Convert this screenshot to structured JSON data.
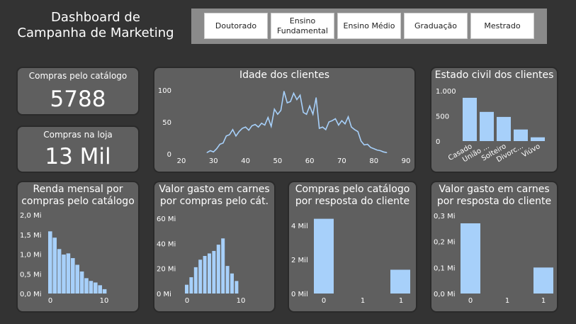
{
  "title_line1": "Dashboard de",
  "title_line2": "Campanha de Marketing",
  "slicer": [
    "Doutorado",
    "Ensino Fundamental",
    "Ensino Médio",
    "Graduação",
    "Mestrado"
  ],
  "kpis": {
    "catalog": {
      "label": "Compras pelo catálogo",
      "value": "5788"
    },
    "store": {
      "label": "Compras na loja",
      "value": "13 Mil"
    }
  },
  "colors": {
    "background": "#333333",
    "card": "#5f5f5f",
    "bar": "#a7d0fa",
    "line": "#a7d0fa",
    "slicer": "#8a8a8a"
  },
  "chart_data": [
    {
      "type": "line",
      "title": "Idade dos clientes",
      "x": [
        28,
        29,
        30,
        31,
        32,
        33,
        34,
        35,
        36,
        37,
        38,
        39,
        40,
        41,
        42,
        43,
        44,
        45,
        46,
        47,
        48,
        49,
        50,
        51,
        52,
        53,
        54,
        55,
        56,
        57,
        58,
        59,
        60,
        61,
        62,
        63,
        64,
        65,
        66,
        67,
        68,
        69,
        70,
        71,
        72,
        73,
        74,
        75,
        76,
        77,
        78,
        79,
        80,
        81,
        82,
        83,
        84
      ],
      "y": [
        2,
        5,
        3,
        8,
        15,
        17,
        28,
        30,
        38,
        28,
        35,
        40,
        42,
        37,
        44,
        46,
        42,
        48,
        45,
        57,
        43,
        70,
        62,
        68,
        98,
        80,
        82,
        95,
        85,
        92,
        65,
        62,
        75,
        62,
        88,
        40,
        42,
        38,
        50,
        52,
        55,
        45,
        52,
        47,
        58,
        42,
        38,
        35,
        20,
        14,
        15,
        10,
        8,
        6,
        5,
        3,
        2
      ],
      "xticks": [
        20,
        30,
        40,
        50,
        60,
        70,
        80,
        90
      ],
      "yticks": [
        0,
        50,
        100
      ],
      "xlim": [
        20,
        90
      ],
      "ylim": [
        0,
        100
      ]
    },
    {
      "type": "bar",
      "title": "Estado civil dos clientes",
      "categories": [
        "Casado",
        "União ...",
        "Solteiro",
        "Divorc...",
        "Viúvo"
      ],
      "values": [
        860,
        580,
        480,
        230,
        75
      ],
      "yticks": [
        "0",
        "500",
        "1.000"
      ],
      "ylim": [
        0,
        1000
      ]
    },
    {
      "type": "bar",
      "title": "Renda mensal por compras pelo catálogo",
      "categories": [
        0,
        1,
        2,
        3,
        4,
        5,
        6,
        7,
        8,
        9,
        10,
        11,
        12
      ],
      "values": [
        1.58,
        1.42,
        1.13,
        0.99,
        1.02,
        0.9,
        0.73,
        0.56,
        0.39,
        0.32,
        0.28,
        0.21,
        0.11
      ],
      "yticks": [
        "0,0 Mi",
        "0,5 Mi",
        "1,0 Mi",
        "1,5 Mi",
        "2,0 Mi"
      ],
      "xticks": [
        "0",
        "10"
      ],
      "ylim": [
        0,
        2.0
      ]
    },
    {
      "type": "bar",
      "title": "Valor gasto em carnes por compras pelo cát.",
      "categories": [
        0,
        1,
        2,
        3,
        4,
        5,
        6,
        7,
        8,
        9,
        10,
        11
      ],
      "values": [
        7,
        13,
        21,
        27,
        30,
        32,
        34,
        39,
        44,
        22,
        16,
        10
      ],
      "yticks": [
        "0 Mi",
        "20 Mi",
        "40 Mi",
        "60 Mi"
      ],
      "xticks": [
        "0",
        "10"
      ],
      "ylim": [
        0,
        60
      ]
    },
    {
      "type": "bar",
      "title": "Compras pelo catálogo por resposta do cliente",
      "categories": [
        "0",
        "1"
      ],
      "values": [
        4.4,
        1.4
      ],
      "yticks": [
        "0 Mil",
        "2 Mil",
        "4 Mil"
      ],
      "xticks": [
        "0",
        "1",
        "1"
      ],
      "ylim": [
        0,
        4.8
      ]
    },
    {
      "type": "bar",
      "title": "Valor gasto em carnes por resposta do cliente",
      "categories": [
        "0",
        "1"
      ],
      "values": [
        0.27,
        0.1
      ],
      "yticks": [
        "0,0 Mi",
        "0,1 Mi",
        "0,2 Mi",
        "0,3 Mi"
      ],
      "xticks": [
        "0",
        "1",
        "1"
      ],
      "ylim": [
        0,
        0.3
      ]
    }
  ]
}
